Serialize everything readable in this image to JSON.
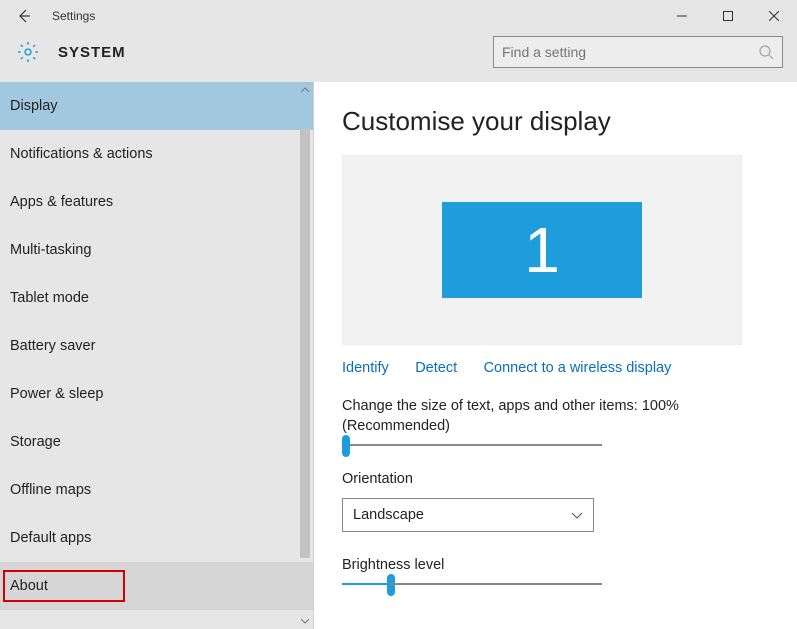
{
  "window": {
    "title": "Settings"
  },
  "header": {
    "system_label": "SYSTEM",
    "search_placeholder": "Find a setting"
  },
  "sidebar": {
    "items": [
      {
        "label": "Display",
        "selected": true
      },
      {
        "label": "Notifications & actions"
      },
      {
        "label": "Apps & features"
      },
      {
        "label": "Multi-tasking"
      },
      {
        "label": "Tablet mode"
      },
      {
        "label": "Battery saver"
      },
      {
        "label": "Power & sleep"
      },
      {
        "label": "Storage"
      },
      {
        "label": "Offline maps"
      },
      {
        "label": "Default apps"
      },
      {
        "label": "About",
        "highlighted": true,
        "framed": true
      }
    ]
  },
  "main": {
    "title": "Customise your display",
    "monitor_id": "1",
    "links": {
      "identify": "Identify",
      "detect": "Detect",
      "connect": "Connect to a wireless display"
    },
    "scale_label": "Change the size of text, apps and other items: 100% (Recommended)",
    "scale_value_percent": 0,
    "orientation_label": "Orientation",
    "orientation_value": "Landscape",
    "brightness_label": "Brightness level",
    "brightness_value_percent": 18
  },
  "colors": {
    "accent": "#1e9ddc",
    "link": "#0a6ebd",
    "sidebar_selected": "#a2c8e0",
    "frame": "#d40000"
  }
}
